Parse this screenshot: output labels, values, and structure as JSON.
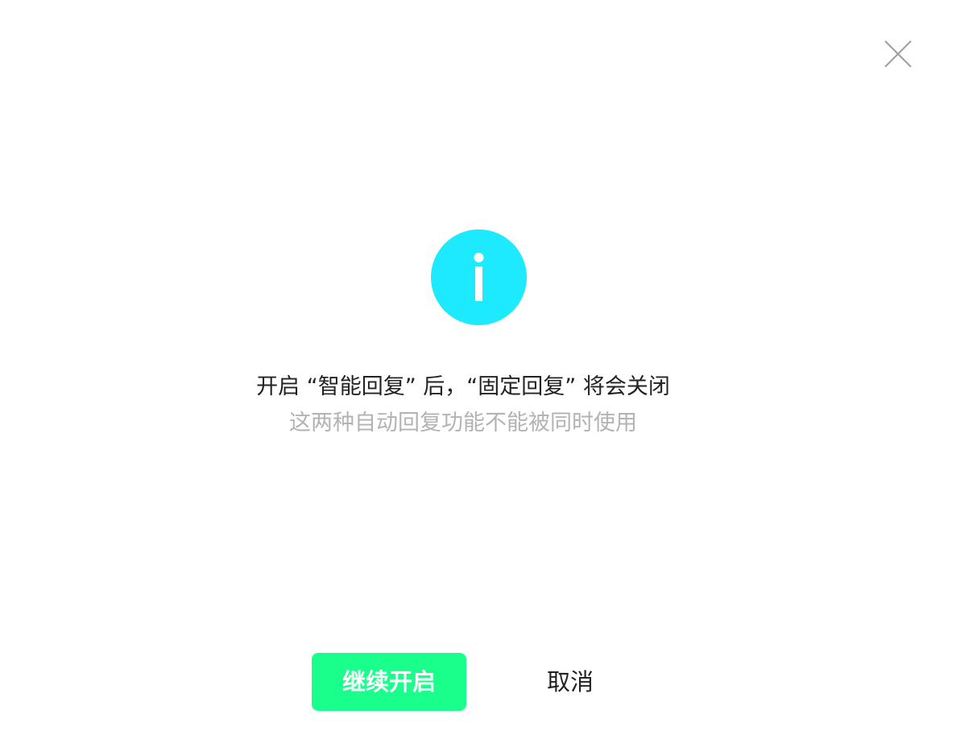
{
  "dialog": {
    "close_icon": "close-icon",
    "info_icon": "info-icon",
    "message": "开启 “智能回复” 后，“固定回复” 将会关闭",
    "submessage": "这两种自动回复功能不能被同时使用",
    "confirm_label": "继续开启",
    "cancel_label": "取消"
  },
  "colors": {
    "info_circle": "#1de9ff",
    "confirm_button": "#1aff8c",
    "close_icon": "#9e9e9e",
    "message_text": "#222222",
    "submessage_text": "#b3b3b3"
  }
}
